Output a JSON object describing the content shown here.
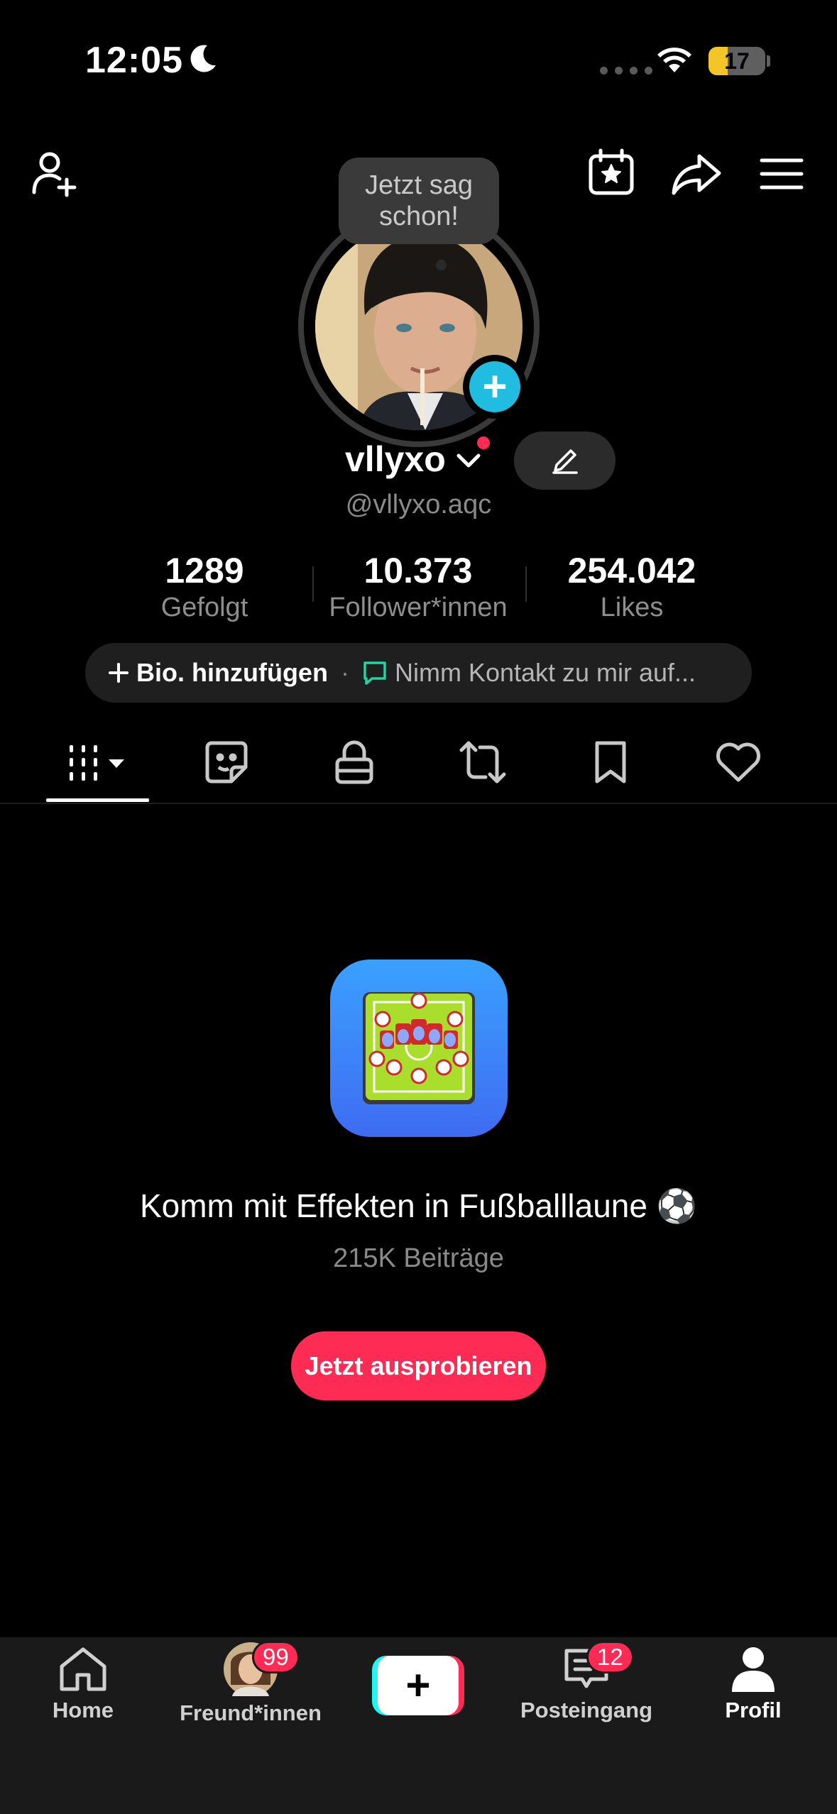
{
  "status_bar": {
    "time": "12:05",
    "battery": "17",
    "battery_level": 0.17
  },
  "tooltip": {
    "text": "Jetzt sag schon!"
  },
  "profile": {
    "username": "vllyxo",
    "handle": "@vllyxo.aqc",
    "stats": [
      {
        "value": "1289",
        "label": "Gefolgt"
      },
      {
        "value": "10.373",
        "label": "Follower*innen"
      },
      {
        "value": "254.042",
        "label": "Likes"
      }
    ],
    "bio_add": "Bio. hinzufügen",
    "bio_separator": "·",
    "contact": "Nimm Kontakt zu mir auf..."
  },
  "tabs": [
    "videos",
    "stickers",
    "private",
    "reposts",
    "saved",
    "liked"
  ],
  "promo": {
    "title": "Komm mit Effekten in Fußballlaune ⚽",
    "subtitle": "215K Beiträge",
    "button": "Jetzt ausprobieren"
  },
  "bottom_nav": {
    "home": "Home",
    "friends": "Freund*innen",
    "friends_badge": "99",
    "inbox": "Posteingang",
    "inbox_badge": "12",
    "profile": "Profil"
  },
  "colors": {
    "accent": "#fe2c55",
    "cyan": "#25f4ee",
    "add_badge": "#20bde0",
    "battery": "#f3c526"
  }
}
